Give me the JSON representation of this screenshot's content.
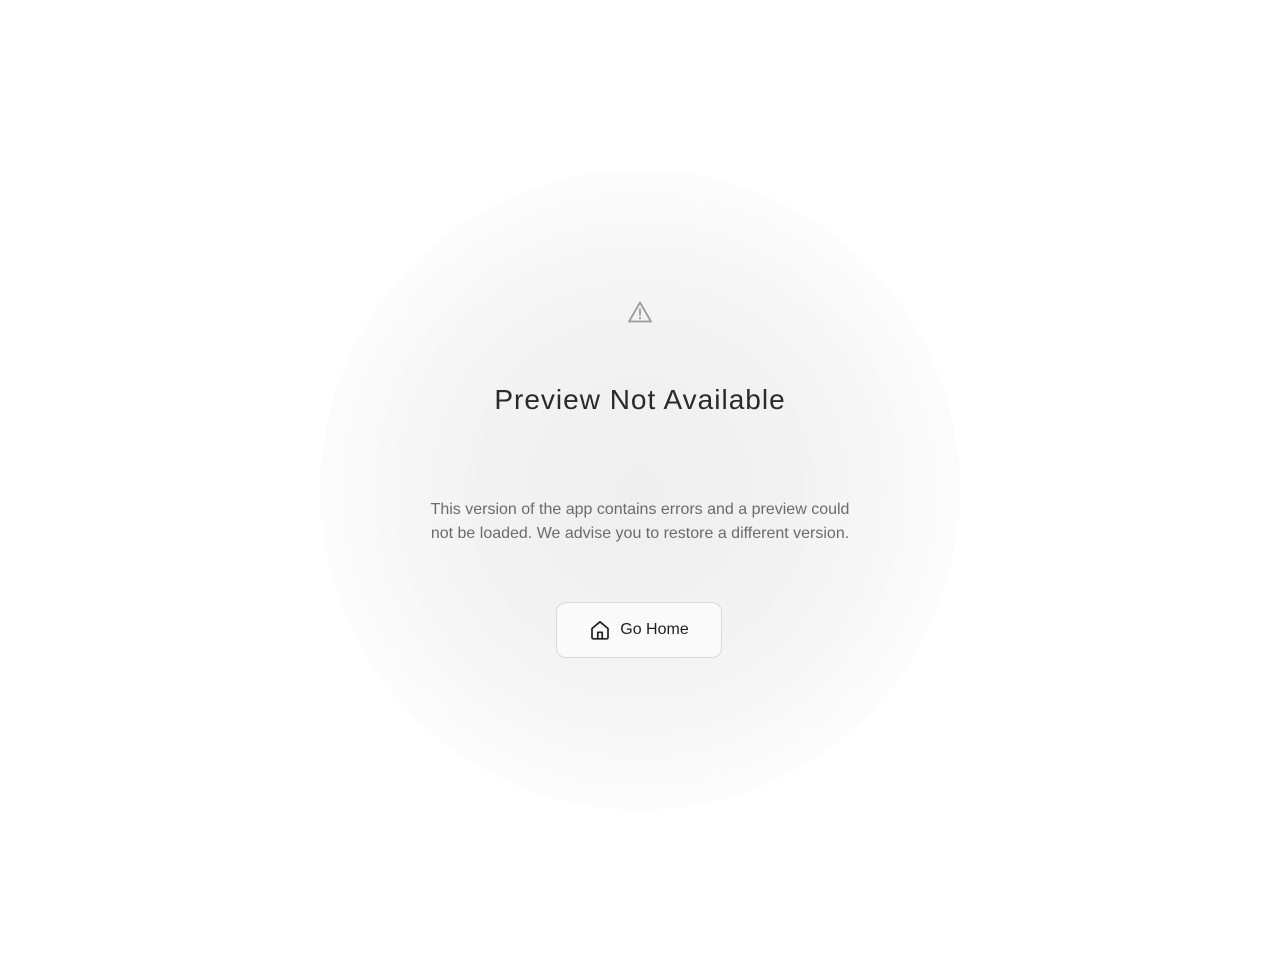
{
  "error": {
    "icon": "warning-triangle-icon",
    "title": "Preview Not Available",
    "message": "This version of the app contains errors and a preview could not be loaded. We advise you to restore a different version."
  },
  "actions": {
    "home_label": "Go Home",
    "home_icon": "home-icon"
  },
  "colors": {
    "background": "#ffffff",
    "title": "#2a2a2a",
    "message": "#6b6b6b",
    "icon": "#9a9a9a",
    "button_border": "#d9d9d9"
  }
}
